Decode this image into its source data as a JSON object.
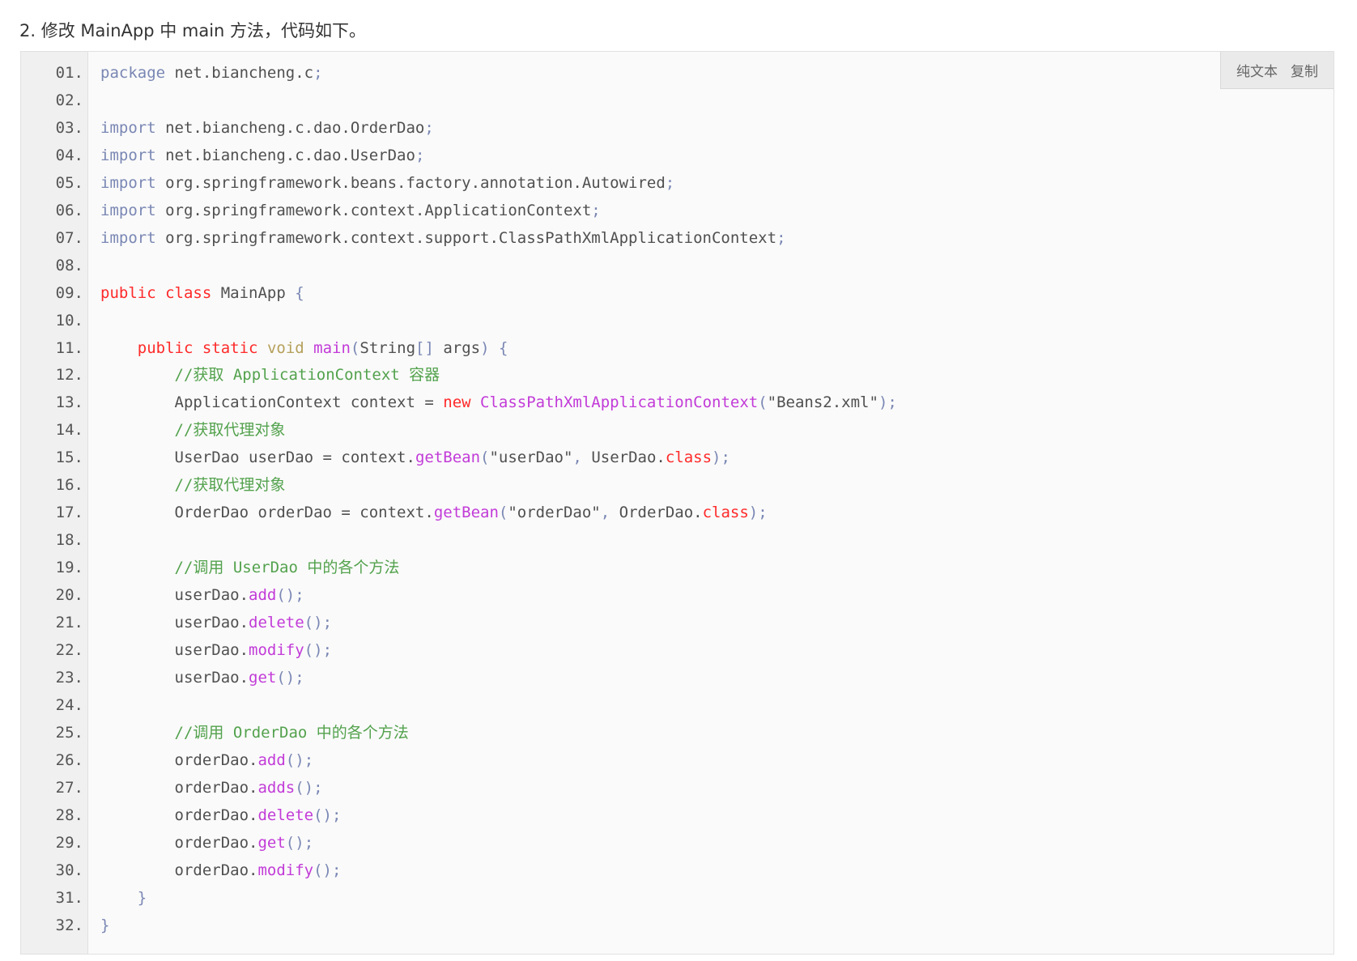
{
  "intro": "2. 修改 MainApp 中 main 方法，代码如下。",
  "toolbar": {
    "plain_text": "纯文本",
    "copy": "复制"
  },
  "colors": {
    "keyword_import": "#7a87b4",
    "keyword_red": "#ff2a2a",
    "method": "#c23bd8",
    "comment": "#53a24d",
    "plain": "#505050"
  },
  "code_lines": [
    {
      "n": "01.",
      "tokens": [
        [
          "kw",
          "package"
        ],
        [
          "pl",
          " net.biancheng.c"
        ],
        [
          "pu",
          ";"
        ]
      ]
    },
    {
      "n": "02.",
      "tokens": []
    },
    {
      "n": "03.",
      "tokens": [
        [
          "kw",
          "import"
        ],
        [
          "pl",
          " net.biancheng.c.dao.OrderDao"
        ],
        [
          "pu",
          ";"
        ]
      ]
    },
    {
      "n": "04.",
      "tokens": [
        [
          "kw",
          "import"
        ],
        [
          "pl",
          " net.biancheng.c.dao.UserDao"
        ],
        [
          "pu",
          ";"
        ]
      ]
    },
    {
      "n": "05.",
      "tokens": [
        [
          "kw",
          "import"
        ],
        [
          "pl",
          " org.springframework.beans.factory.annotation.Autowired"
        ],
        [
          "pu",
          ";"
        ]
      ]
    },
    {
      "n": "06.",
      "tokens": [
        [
          "kw",
          "import"
        ],
        [
          "pl",
          " org.springframework.context.ApplicationContext"
        ],
        [
          "pu",
          ";"
        ]
      ]
    },
    {
      "n": "07.",
      "tokens": [
        [
          "kw",
          "import"
        ],
        [
          "pl",
          " org.springframework.context.support.ClassPathXmlApplicationContext"
        ],
        [
          "pu",
          ";"
        ]
      ]
    },
    {
      "n": "08.",
      "tokens": []
    },
    {
      "n": "09.",
      "tokens": [
        [
          "kw2",
          "public class"
        ],
        [
          "pl",
          " MainApp "
        ],
        [
          "pu",
          "{"
        ]
      ]
    },
    {
      "n": "10.",
      "tokens": []
    },
    {
      "n": "11.",
      "tokens": [
        [
          "pl",
          "    "
        ],
        [
          "kw2",
          "public static"
        ],
        [
          "pl",
          " "
        ],
        [
          "ty",
          "void"
        ],
        [
          "pl",
          " "
        ],
        [
          "fn",
          "main"
        ],
        [
          "pu",
          "("
        ],
        [
          "pl",
          "String"
        ],
        [
          "pu",
          "[]"
        ],
        [
          "pl",
          " args"
        ],
        [
          "pu",
          ")"
        ],
        [
          "pl",
          " "
        ],
        [
          "pu",
          "{"
        ]
      ]
    },
    {
      "n": "12.",
      "tokens": [
        [
          "pl",
          "        "
        ],
        [
          "cm",
          "//获取 ApplicationContext 容器"
        ]
      ]
    },
    {
      "n": "13.",
      "tokens": [
        [
          "pl",
          "        ApplicationContext context = "
        ],
        [
          "kw2",
          "new"
        ],
        [
          "pl",
          " "
        ],
        [
          "fn",
          "ClassPathXmlApplicationContext"
        ],
        [
          "pu",
          "("
        ],
        [
          "str",
          "\"Beans2.xml\""
        ],
        [
          "pu",
          ")"
        ],
        [
          "pu",
          ";"
        ]
      ]
    },
    {
      "n": "14.",
      "tokens": [
        [
          "pl",
          "        "
        ],
        [
          "cm",
          "//获取代理对象"
        ]
      ]
    },
    {
      "n": "15.",
      "tokens": [
        [
          "pl",
          "        UserDao userDao = context."
        ],
        [
          "fn",
          "getBean"
        ],
        [
          "pu",
          "("
        ],
        [
          "str",
          "\"userDao\""
        ],
        [
          "pu",
          ","
        ],
        [
          "pl",
          " UserDao."
        ],
        [
          "kw2",
          "class"
        ],
        [
          "pu",
          ")"
        ],
        [
          "pu",
          ";"
        ]
      ]
    },
    {
      "n": "16.",
      "tokens": [
        [
          "pl",
          "        "
        ],
        [
          "cm",
          "//获取代理对象"
        ]
      ]
    },
    {
      "n": "17.",
      "tokens": [
        [
          "pl",
          "        OrderDao orderDao = context."
        ],
        [
          "fn",
          "getBean"
        ],
        [
          "pu",
          "("
        ],
        [
          "str",
          "\"orderDao\""
        ],
        [
          "pu",
          ","
        ],
        [
          "pl",
          " OrderDao."
        ],
        [
          "kw2",
          "class"
        ],
        [
          "pu",
          ")"
        ],
        [
          "pu",
          ";"
        ]
      ]
    },
    {
      "n": "18.",
      "tokens": []
    },
    {
      "n": "19.",
      "tokens": [
        [
          "pl",
          "        "
        ],
        [
          "cm",
          "//调用 UserDao 中的各个方法"
        ]
      ]
    },
    {
      "n": "20.",
      "tokens": [
        [
          "pl",
          "        userDao."
        ],
        [
          "fn",
          "add"
        ],
        [
          "pu",
          "()"
        ],
        [
          "pu",
          ";"
        ]
      ]
    },
    {
      "n": "21.",
      "tokens": [
        [
          "pl",
          "        userDao."
        ],
        [
          "fn",
          "delete"
        ],
        [
          "pu",
          "()"
        ],
        [
          "pu",
          ";"
        ]
      ]
    },
    {
      "n": "22.",
      "tokens": [
        [
          "pl",
          "        userDao."
        ],
        [
          "fn",
          "modify"
        ],
        [
          "pu",
          "()"
        ],
        [
          "pu",
          ";"
        ]
      ]
    },
    {
      "n": "23.",
      "tokens": [
        [
          "pl",
          "        userDao."
        ],
        [
          "fn",
          "get"
        ],
        [
          "pu",
          "()"
        ],
        [
          "pu",
          ";"
        ]
      ]
    },
    {
      "n": "24.",
      "tokens": []
    },
    {
      "n": "25.",
      "tokens": [
        [
          "pl",
          "        "
        ],
        [
          "cm",
          "//调用 OrderDao 中的各个方法"
        ]
      ]
    },
    {
      "n": "26.",
      "tokens": [
        [
          "pl",
          "        orderDao."
        ],
        [
          "fn",
          "add"
        ],
        [
          "pu",
          "()"
        ],
        [
          "pu",
          ";"
        ]
      ]
    },
    {
      "n": "27.",
      "tokens": [
        [
          "pl",
          "        orderDao."
        ],
        [
          "fn",
          "adds"
        ],
        [
          "pu",
          "()"
        ],
        [
          "pu",
          ";"
        ]
      ]
    },
    {
      "n": "28.",
      "tokens": [
        [
          "pl",
          "        orderDao."
        ],
        [
          "fn",
          "delete"
        ],
        [
          "pu",
          "()"
        ],
        [
          "pu",
          ";"
        ]
      ]
    },
    {
      "n": "29.",
      "tokens": [
        [
          "pl",
          "        orderDao."
        ],
        [
          "fn",
          "get"
        ],
        [
          "pu",
          "()"
        ],
        [
          "pu",
          ";"
        ]
      ]
    },
    {
      "n": "30.",
      "tokens": [
        [
          "pl",
          "        orderDao."
        ],
        [
          "fn",
          "modify"
        ],
        [
          "pu",
          "()"
        ],
        [
          "pu",
          ";"
        ]
      ]
    },
    {
      "n": "31.",
      "tokens": [
        [
          "pl",
          "    "
        ],
        [
          "pu",
          "}"
        ]
      ]
    },
    {
      "n": "32.",
      "tokens": [
        [
          "pu",
          "}"
        ]
      ]
    }
  ]
}
